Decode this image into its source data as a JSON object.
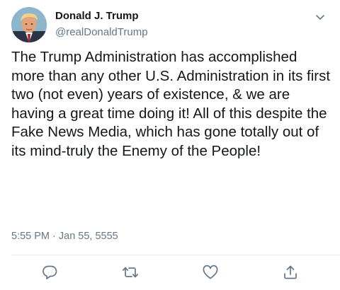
{
  "tweet": {
    "display_name": "Donald J. Trump",
    "handle": "@realDonaldTrump",
    "text": "The Trump Administration has accomplished more than any other U.S. Administration in its first two (not even) years of existence, & we are having a great time doing it! All of this despite the Fake News Media, which has gone totally out of its mind-truly the Enemy of the People!",
    "timestamp": "5:55 PM · Jan 55, 5555"
  },
  "icons": {
    "menu": "chevron-down-icon",
    "reply": "reply-icon",
    "retweet": "retweet-icon",
    "like": "heart-icon",
    "share": "share-icon"
  },
  "colors": {
    "text": "#14171a",
    "secondary": "#657786",
    "divider": "#e6ecf0",
    "icon": "#657786"
  }
}
